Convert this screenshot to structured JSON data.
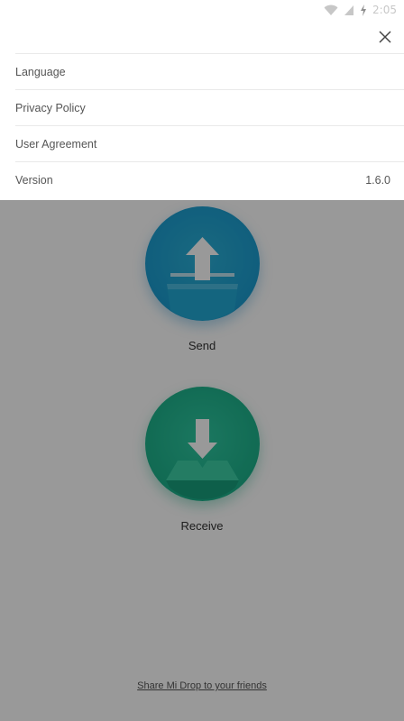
{
  "status_bar": {
    "time": "2:05",
    "icons": [
      "wifi-icon",
      "signal-icon",
      "charging-icon"
    ]
  },
  "settings_sheet": {
    "close_icon": "close-icon",
    "items": [
      {
        "label": "Language",
        "value": ""
      },
      {
        "label": "Privacy Policy",
        "value": ""
      },
      {
        "label": "User Agreement",
        "value": ""
      },
      {
        "label": "Version",
        "value": "1.6.0"
      }
    ]
  },
  "main": {
    "send_label": "Send",
    "receive_label": "Receive",
    "share_link": "Share Mi Drop to your friends",
    "send_color": "#1d9fd1",
    "receive_color": "#1fb48d"
  }
}
